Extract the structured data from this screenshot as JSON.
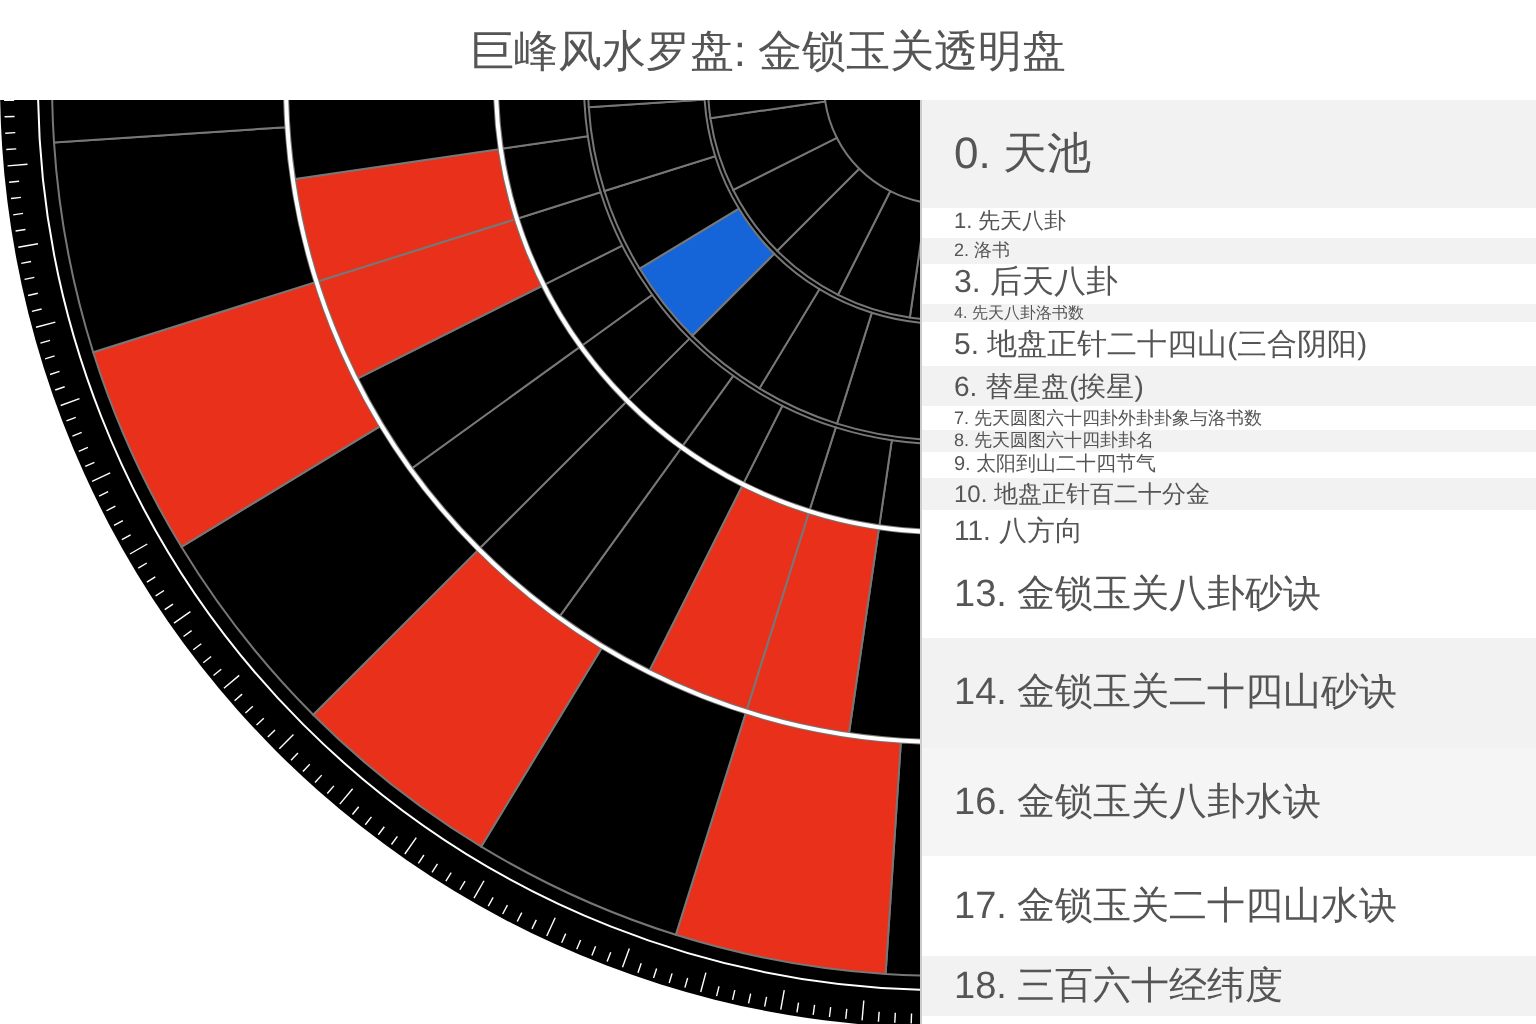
{
  "title": "巨峰风水罗盘: 金锁玉关透明盘",
  "layers": [
    {
      "label": "0. 天池"
    },
    {
      "label": "1. 先天八卦"
    },
    {
      "label": "2. 洛书"
    },
    {
      "label": "3. 后天八卦"
    },
    {
      "label": "4. 先天八卦洛书数"
    },
    {
      "label": "5. 地盘正针二十四山(三合阴阳)"
    },
    {
      "label": "6. 替星盘(挨星)"
    },
    {
      "label": "7. 先天圆图六十四卦外卦卦象与洛书数"
    },
    {
      "label": "8. 先天圆图六十四卦卦名"
    },
    {
      "label": "9. 太阳到山二十四节气"
    },
    {
      "label": "10. 地盘正针百二十分金"
    },
    {
      "label": "11. 八方向"
    },
    {
      "label": "13. 金锁玉关八卦砂诀"
    },
    {
      "label": "14. 金锁玉关二十四山砂诀"
    },
    {
      "label": "16. 金锁玉关八卦水诀"
    },
    {
      "label": "17. 金锁玉关二十四山水诀"
    },
    {
      "label": "18. 三百六十经纬度"
    }
  ]
}
